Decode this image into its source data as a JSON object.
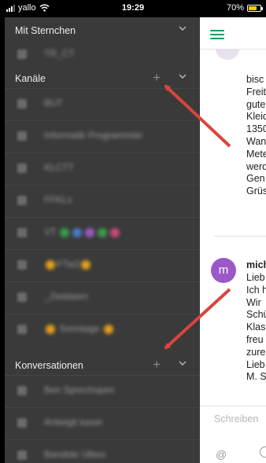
{
  "status_bar": {
    "carrier": "yallo",
    "time": "19:29",
    "battery": "70%",
    "battery_level": 0.7
  },
  "sidebar": {
    "sections": [
      {
        "title": "Mit Sternchen",
        "has_add": false
      },
      {
        "title": "Kanäle",
        "has_add": true,
        "add_label": "+"
      },
      {
        "title": "Konversationen",
        "has_add": true,
        "add_label": "+"
      }
    ],
    "starred_items": [
      "TR_CT"
    ],
    "channels": [
      "BUT",
      "Informatik Programmier",
      "KLCTT",
      "FFKLs",
      "VT",
      "FTw2",
      "_Zieldaten",
      "Sonntage"
    ],
    "conversations": [
      "Ben Sprechopen",
      "Antwigti kaser",
      "Bandide Ulbes"
    ]
  },
  "main": {
    "message_1_lines": [
      "bisс",
      "Freit",
      "gute",
      "Kleid",
      "1350",
      "Wan",
      "Mete",
      "werd",
      "Gen",
      "Grüs"
    ],
    "avatar_letter": "m",
    "sender": "mich",
    "message_2_lines": [
      "Lieb",
      "Ich h",
      "Wir",
      "Schü",
      "Klas",
      "freu",
      "zure",
      "Lieb",
      "M. S"
    ],
    "composer_placeholder": "Schreiben",
    "at_symbol": "@"
  },
  "colors": {
    "sidebar_bg": "#3a3a3a",
    "accent_green": "#1d9b5f",
    "avatar_purple": "#9b59c8",
    "arrow_red": "#d9453d"
  }
}
